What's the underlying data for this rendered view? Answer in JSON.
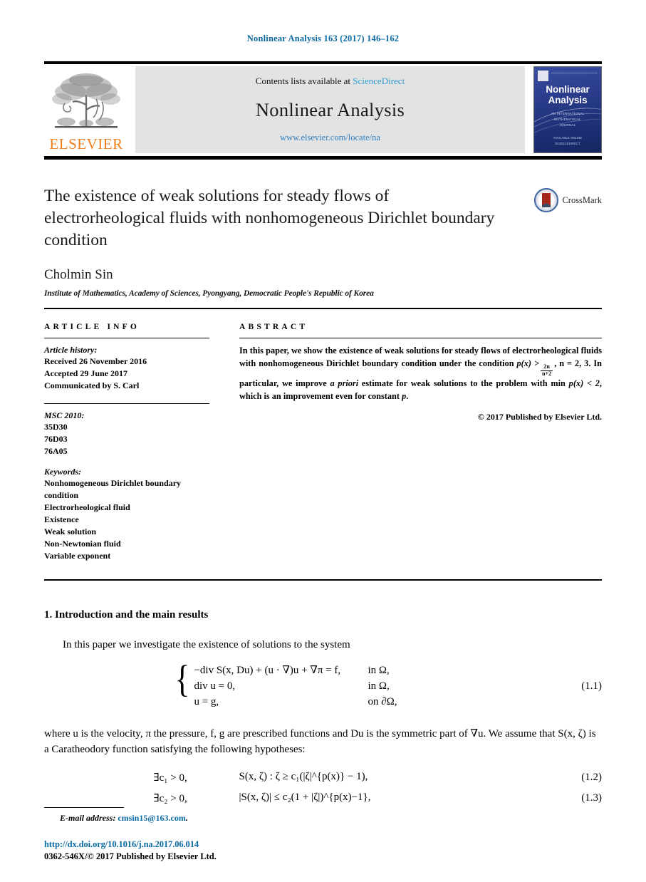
{
  "running_head": "Nonlinear Analysis 163 (2017) 146–162",
  "masthead": {
    "publisher_wordmark": "ELSEVIER",
    "contents_prefix": "Contents lists available at",
    "contents_link": "ScienceDirect",
    "journal_name": "Nonlinear Analysis",
    "journal_url": "www.elsevier.com/locate/na",
    "cover": {
      "title_line1": "Nonlinear",
      "title_line2": "Analysis",
      "subtitle_line1": "AN INTERNATIONAL",
      "subtitle_line2": "MATHEMATICAL",
      "subtitle_line3": "JOURNAL",
      "footer_line1": "AVAILABLE ONLINE",
      "footer_line2": "SCIENCEDIRECT"
    }
  },
  "article": {
    "title": "The existence of weak solutions for steady flows of electrorheological fluids with nonhomogeneous Dirichlet boundary condition",
    "crossmark_label": "CrossMark",
    "author": "Cholmin Sin",
    "affiliation": "Institute of Mathematics, Academy of Sciences, Pyongyang, Democratic People's Republic of Korea"
  },
  "info": {
    "heading": "ARTICLE INFO",
    "history_heading": "Article history:",
    "history": [
      "Received 26 November 2016",
      "Accepted 29 June 2017",
      "Communicated by S. Carl"
    ],
    "msc_heading": "MSC 2010:",
    "msc": [
      "35D30",
      "76D03",
      "76A05"
    ],
    "keywords_heading": "Keywords:",
    "keywords": [
      "Nonhomogeneous Dirichlet boundary",
      "condition",
      "Electrorheological fluid",
      "Existence",
      "Weak solution",
      "Non-Newtonian fluid",
      "Variable exponent"
    ]
  },
  "abstract": {
    "heading": "ABSTRACT",
    "part1": "In this paper, we show the existence of weak solutions for steady flows of electrorheological fluids with nonhomogeneous Dirichlet boundary condition under the condition ",
    "math_p": "p(x) >",
    "frac_num": "2n",
    "frac_den": "n+2",
    "part2": ", n = 2, 3. In particular, we improve ",
    "apriori": "a priori",
    "part3": " estimate for weak solutions to the problem with min ",
    "math_min": "p(x) < 2",
    "part4": ", which is an improvement even for constant ",
    "math_p2": "p",
    "part5": ".",
    "copyright": "© 2017 Published by Elsevier Ltd."
  },
  "body": {
    "section_number": "1.",
    "section_title": "Introduction and the main results",
    "paragraph1": "In this paper we investigate the existence of solutions to the system",
    "eq11": {
      "number": "(1.1)",
      "lines": [
        {
          "lhs": "−div S(x, Du) + (u · ∇)u + ∇π = f,",
          "rhs": "in Ω,"
        },
        {
          "lhs": "div u = 0,",
          "rhs": "in Ω,"
        },
        {
          "lhs": "u = g,",
          "rhs": "on ∂Ω,"
        }
      ]
    },
    "paragraph2_line1": "where u is the velocity, π the pressure, f, g are prescribed functions and Du is the symmetric part of ∇u.",
    "paragraph2_line2": "We assume that S(x, ζ) is a Caratheodory function satisfying the following hypotheses:",
    "eq12": {
      "number": "(1.2)",
      "condition": "∃c₁ > 0,",
      "expression": "S(x, ζ) : ζ ≥ c₁(|ζ|^{p(x)} − 1),"
    },
    "eq13": {
      "number": "(1.3)",
      "condition": "∃c₂ > 0,",
      "expression": "|S(x, ζ)| ≤ c₂(1 + |ζ|)^{p(x)−1},"
    }
  },
  "footer": {
    "email_label": "E-mail address:",
    "email": "cmsin15@163.com",
    "email_period": ".",
    "doi": "http://dx.doi.org/10.1016/j.na.2017.06.014",
    "issn_line": "0362-546X/© 2017 Published by Elsevier Ltd."
  },
  "colors": {
    "link_blue": "#0b6aa2",
    "sciencedirect_blue": "#2f9fd0",
    "elsevier_orange": "#F07F1A",
    "cover_blue": "#23357f"
  }
}
